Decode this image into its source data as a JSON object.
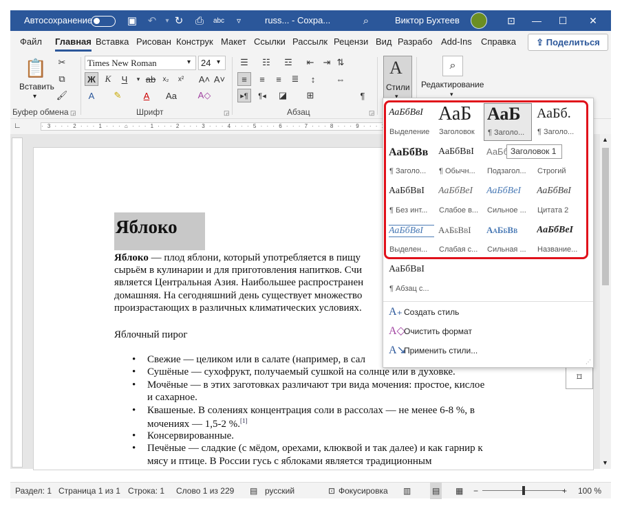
{
  "titlebar": {
    "autosave_label": "Автосохранение",
    "doc_title": "russ...  -  Сохра...",
    "user_name": "Виктор Бухтеев",
    "abc_label": "abc"
  },
  "menu": {
    "tabs": [
      "Файл",
      "Главная",
      "Вставка",
      "Рисован",
      "Конструк",
      "Макет",
      "Ссылки",
      "Рассылк",
      "Рецензи",
      "Вид",
      "Разрабо",
      "Add-Ins",
      "Справка"
    ],
    "share": "Поделиться"
  },
  "ribbon": {
    "paste_label": "Вставить",
    "font_name": "Times New Roman",
    "font_size": "24",
    "bold": "Ж",
    "italic": "К",
    "underline": "Ч",
    "styles_label": "Стили",
    "editing_label": "Редактирование",
    "groups": {
      "clipboard": "Буфер обмена",
      "font": "Шрифт",
      "paragraph": "Абзац"
    }
  },
  "ruler_text": "· 3 · · · 2 · · · 1 · · · ⌂ · · · 1 · · · 2 · · · 3 · · · 4 · · · 5 · · · 6 · · · 7 · · · 8 · · · 9 · · · 10 · · · 11 · · · 12 · · · 13 · · · 14 · · · 15 · · · 16 · · · 17 ·",
  "document": {
    "heading": "Яблоко",
    "p1_bold": "Яблоко",
    "p1_l1": " — плод яблони, который употребляется в пищу",
    "p1_l2": "сырьём в кулинарии и для приготовления напитков. Счи",
    "p1_l3": "является Центральная Азия. Наибольшее распространен",
    "p1_l4": "домашняя. На сегодняшний день существует множество",
    "p1_l5": "произрастающих в различных климатических условиях.",
    "subheading": "Яблочный пирог",
    "bullets": [
      "Свежие — целиком или в салате (например, в сал",
      "Сушёные — сухофрукт, получаемый сушкой на солнце или в духовке.",
      "Мочёные — в этих заготовках различают три вида мочения: простое, кислое",
      "и сахарное.",
      "Квашеные. В солениях концентрация соли в рассолах — не менее 6-8 %, в",
      "мочениях — 1,5-2 %.",
      "Консервированные.",
      "Печёные — сладкие (с мёдом, орехами, клюквой и так далее) и как гарнир к",
      "мясу и птице. В России гусь с яблоками является традиционным"
    ],
    "footnote": "[1]"
  },
  "styles_gallery": {
    "items": [
      {
        "sample": "АаБбВвІ",
        "label": "Выделение"
      },
      {
        "sample": "АаБ",
        "label": "Заголовок"
      },
      {
        "sample": "АаБ",
        "label": "¶ Заголо..."
      },
      {
        "sample": "АаБб.",
        "label": "¶ Заголо..."
      },
      {
        "sample": "АаБбВв",
        "label": "¶ Заголо..."
      },
      {
        "sample": "АаБбВвІ",
        "label": "¶ Обычн..."
      },
      {
        "sample": "АаБбВ",
        "label": "Подзагол..."
      },
      {
        "sample": "бВв.",
        "label": "Строгий"
      },
      {
        "sample": "АаБбВвІ",
        "label": "¶ Без инт..."
      },
      {
        "sample": "АаБбВеІ",
        "label": "Слабое в..."
      },
      {
        "sample": "АаБбВеІ",
        "label": "Сильное ..."
      },
      {
        "sample": "АаБбВвІ",
        "label": "Цитата 2"
      },
      {
        "sample": "АаБбВвІ",
        "label": "Выделен..."
      },
      {
        "sample": "АаБбВвІ",
        "label": "Слабая с..."
      },
      {
        "sample": "АаБбВв",
        "label": "Сильная ..."
      },
      {
        "sample": "АаБбВеІ",
        "label": "Название..."
      },
      {
        "sample": "АаБбВвІ",
        "label": "¶ Абзац с..."
      }
    ],
    "tooltip": "Заголовок 1",
    "commands": [
      "Создать стиль",
      "Очистить формат",
      "Применить стили..."
    ]
  },
  "status": {
    "section": "Раздел: 1",
    "page": "Страница 1 из 1",
    "line": "Строка: 1",
    "words": "Слово 1 из 229",
    "language": "русский",
    "focus": "Фокусировка",
    "zoom": "100 %"
  },
  "colors": {
    "accent": "#2b579a",
    "highlight": "#e0101a"
  }
}
